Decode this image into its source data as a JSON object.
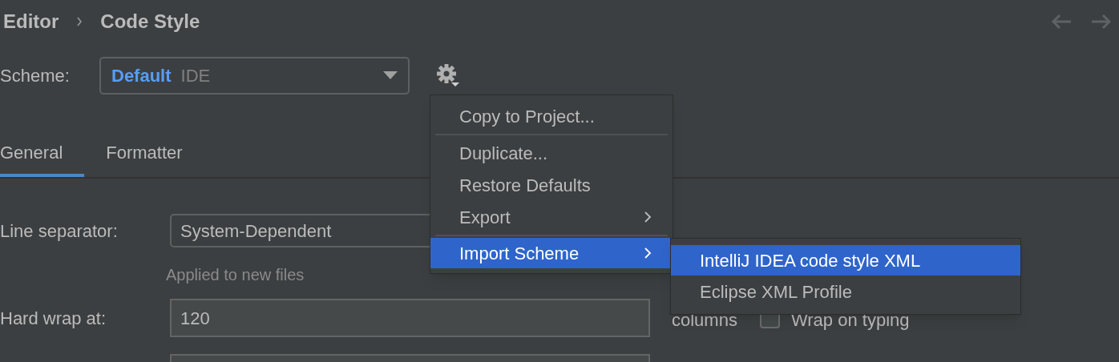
{
  "breadcrumb": [
    "Editor",
    "Code Style"
  ],
  "scheme": {
    "label": "Scheme:",
    "name": "Default",
    "scope": "IDE"
  },
  "tabs": [
    {
      "label": "General",
      "selected": true
    },
    {
      "label": "Formatter",
      "selected": false
    }
  ],
  "line_separator": {
    "label": "Line separator:",
    "value": "System-Dependent",
    "hint": "Applied to new files"
  },
  "hard_wrap": {
    "label": "Hard wrap at:",
    "value": "120",
    "suffix": "columns"
  },
  "wrap_on_typing": {
    "label": "Wrap on typing",
    "checked": false
  },
  "menu": [
    {
      "label": "Copy to Project...",
      "submenu": false,
      "selected": false,
      "separator_after": true
    },
    {
      "label": "Duplicate...",
      "submenu": false,
      "selected": false,
      "separator_after": false
    },
    {
      "label": "Restore Defaults",
      "submenu": false,
      "selected": false,
      "separator_after": false
    },
    {
      "label": "Export",
      "submenu": true,
      "selected": false,
      "separator_after": true
    },
    {
      "label": "Import Scheme",
      "submenu": true,
      "selected": true,
      "separator_after": false
    }
  ],
  "submenu": [
    {
      "label": "IntelliJ IDEA code style XML",
      "selected": true
    },
    {
      "label": "Eclipse XML Profile",
      "selected": false
    }
  ]
}
